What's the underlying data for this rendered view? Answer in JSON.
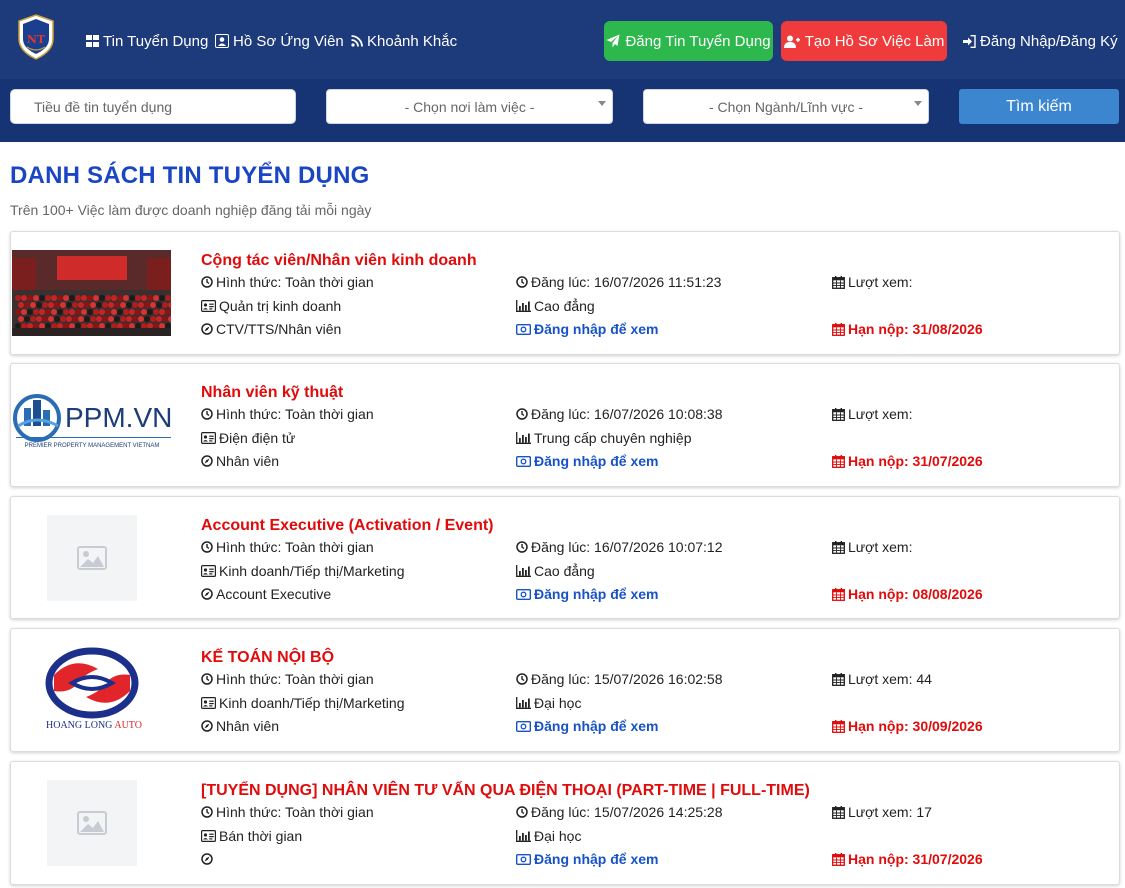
{
  "nav": {
    "logo_caption": "NGUYEN TAT THANH",
    "links": [
      {
        "label": "Tin Tuyển Dụng",
        "icon": "grid-icon"
      },
      {
        "label": "Hồ Sơ Ứng Viên",
        "icon": "id-card-icon"
      },
      {
        "label": "Khoảnh Khắc",
        "icon": "rss-icon"
      }
    ],
    "post_job_label": "Đăng Tin Tuyển Dụng",
    "create_profile_label": "Tạo Hồ Sơ Việc Làm",
    "login_label": "Đăng Nhập/Đăng Ký"
  },
  "search": {
    "title_placeholder": "Tiều đề tin tuyển dụng",
    "location_select": "- Chọn nơi làm việc -",
    "industry_select": "- Chọn Ngành/Lĩnh vực -",
    "button_label": "Tìm kiếm"
  },
  "section": {
    "title": "DANH SÁCH TIN TUYỂN DỤNG",
    "subtitle": "Trên 100+ Việc làm được doanh nghiệp đăng tải mỗi ngày"
  },
  "jobs": [
    {
      "title": "Cộng tác viên/Nhân viên kinh doanh",
      "work_type": "Hình thức: Toàn thời gian",
      "field": "Quản trị kinh doanh",
      "position": "CTV/TTS/Nhân viên",
      "posted": "Đăng lúc: 16/07/2026 11:51:23",
      "level": "Cao đẳng",
      "salary": "Đăng nhập để xem",
      "views": "Lượt xem: ",
      "deadline": "Hạn nộp: 31/08/2026",
      "thumb": "group-photo"
    },
    {
      "title": "Nhân viên kỹ thuật",
      "work_type": "Hình thức: Toàn thời gian",
      "field": "Điện điện tử",
      "position": "Nhân viên",
      "posted": "Đăng lúc: 16/07/2026 10:08:38",
      "level": "Trung cấp chuyên nghiệp",
      "salary": "Đăng nhập để xem",
      "views": "Lượt xem: ",
      "deadline": "Hạn nộp: 31/07/2026",
      "thumb": "ppm-logo",
      "logo_text": "PPM.VN",
      "logo_sub": "PREMIER PROPERTY MANAGEMENT VIETNAM"
    },
    {
      "title": "Account Executive (Activation / Event)",
      "work_type": "Hình thức: Toàn thời gian",
      "field": "Kinh doanh/Tiếp thị/Marketing",
      "position": "Account Executive",
      "posted": "Đăng lúc: 16/07/2026 10:07:12",
      "level": "Cao đẳng",
      "salary": "Đăng nhập để xem",
      "views": "Lượt xem: ",
      "deadline": "Hạn nộp: 08/08/2026",
      "thumb": "placeholder"
    },
    {
      "title": "KẾ TOÁN NỘI BỘ",
      "work_type": "Hình thức: Toàn thời gian",
      "field": "Kinh doanh/Tiếp thị/Marketing",
      "position": "Nhân viên",
      "posted": "Đăng lúc: 15/07/2026 16:02:58",
      "level": "Đại học",
      "salary": "Đăng nhập để xem",
      "views": "Lượt xem: 44",
      "deadline": "Hạn nộp: 30/09/2026",
      "thumb": "hoang-long-logo",
      "logo_text_a": "HOANG LONG ",
      "logo_text_b": "AUTO"
    },
    {
      "title": "[TUYỂN DỤNG] NHÂN VIÊN TƯ VẤN QUA ĐIỆN THOẠI (PART-TIME | FULL-TIME)",
      "work_type": "Hình thức: Toàn thời gian",
      "field": "Bán thời gian",
      "position": "",
      "posted": "Đăng lúc: 15/07/2026 14:25:28",
      "level": "Đại học",
      "salary": "Đăng nhập để xem",
      "views": "Lượt xem: 17",
      "deadline": "Hạn nộp: 31/07/2026",
      "thumb": "placeholder"
    }
  ],
  "colors": {
    "navbar": "#1d3a7a",
    "searchbar": "#163473",
    "title_blue": "#1a46c4",
    "job_red": "#e00b0b",
    "link_blue": "#1753c7",
    "btn_green": "#2db84d",
    "btn_red": "#ef3b3b",
    "search_btn": "#3b86cf"
  }
}
